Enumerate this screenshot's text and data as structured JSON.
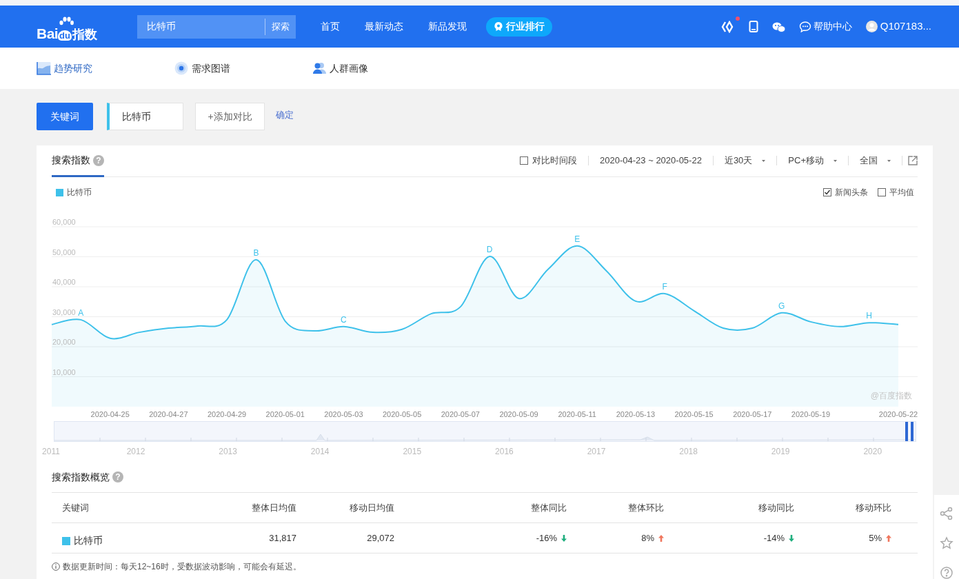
{
  "header": {
    "logo": {
      "left": "Bai",
      "badge": "du",
      "right": "指数"
    },
    "search": {
      "value": "比特币",
      "button": "探索"
    },
    "nav": [
      {
        "label": "首页",
        "kind": "link"
      },
      {
        "label": "最新动态",
        "kind": "link"
      },
      {
        "label": "新品发现",
        "kind": "link"
      },
      {
        "label": "行业排行",
        "kind": "pill"
      }
    ],
    "notification_dot": true,
    "help": "帮助中心",
    "user": "Q107183..."
  },
  "subnav": [
    {
      "label": "趋势研究",
      "selected": true,
      "kind": "trend"
    },
    {
      "label": "需求图谱",
      "selected": false,
      "kind": "radar"
    },
    {
      "label": "人群画像",
      "selected": false,
      "kind": "people"
    }
  ],
  "keyword_bar": {
    "label": "关键词",
    "keyword": "比特币",
    "add": "+添加对比",
    "confirm": "确定"
  },
  "index_card": {
    "tab": "搜索指数",
    "compare_period": {
      "label": "对比时间段",
      "checked": false
    },
    "date_range": "2020-04-23 ~ 2020-05-22",
    "dropdowns": [
      "近30天",
      "PC+移动",
      "全国"
    ],
    "toggles": [
      {
        "label": "新闻头条",
        "checked": true
      },
      {
        "label": "平均值",
        "checked": false
      }
    ],
    "credit": "@百度指数",
    "help_icon": "?",
    "chart_data": {
      "type": "line",
      "grid": true,
      "categories": [
        null,
        null,
        "2020-04-25",
        null,
        "2020-04-27",
        null,
        "2020-04-29",
        null,
        "2020-05-01",
        null,
        "2020-05-03",
        null,
        "2020-05-05",
        null,
        "2020-05-07",
        null,
        "2020-05-09",
        null,
        "2020-05-11",
        null,
        "2020-05-13",
        null,
        "2020-05-15",
        null,
        "2020-05-17",
        null,
        "2020-05-19",
        null,
        null,
        "2020-05-22"
      ],
      "series": [
        {
          "name": "比特币",
          "color": "#3ec1ea",
          "values": [
            27400,
            29000,
            22800,
            24800,
            26200,
            26900,
            29000,
            49000,
            28500,
            25300,
            26700,
            24800,
            25800,
            31000,
            33300,
            50100,
            36100,
            45800,
            53600,
            45300,
            35200,
            37700,
            32000,
            26200,
            26200,
            31300,
            28300,
            26700,
            28000,
            27400
          ]
        }
      ],
      "ylim": [
        0,
        60000
      ],
      "yticks": [
        {
          "value": 10000,
          "label": "10,000"
        },
        {
          "value": 20000,
          "label": "20,000"
        },
        {
          "value": 30000,
          "label": "30,000"
        },
        {
          "value": 40000,
          "label": "40,000"
        },
        {
          "value": 50000,
          "label": "50,000"
        },
        {
          "value": 60000,
          "label": "60,000"
        }
      ],
      "annotations": [
        "A",
        "B",
        "C",
        "D",
        "E",
        "F",
        "G",
        "H"
      ]
    },
    "navigator": {
      "years": [
        "2011",
        "2012",
        "2013",
        "2014",
        "2015",
        "2016",
        "2017",
        "2018",
        "2019",
        "2020"
      ]
    }
  },
  "overview": {
    "title": "搜索指数概览",
    "help_icon": "?",
    "columns": [
      "关键词",
      "整体日均值",
      "移动日均值",
      "整体同比",
      "整体环比",
      "移动同比",
      "移动环比"
    ],
    "rows": [
      {
        "keyword": "比特币",
        "color": "#3ec1ea",
        "avg_all": "31,817",
        "avg_mobile": "29,072",
        "changes": [
          {
            "text": "-16%",
            "rising": false
          },
          {
            "text": "8%",
            "rising": true
          },
          {
            "text": "-14%",
            "rising": false
          },
          {
            "text": "5%",
            "rising": true
          }
        ]
      }
    ],
    "note": "数据更新时间：每天12~16时，受数据波动影响，可能会有延迟。"
  }
}
